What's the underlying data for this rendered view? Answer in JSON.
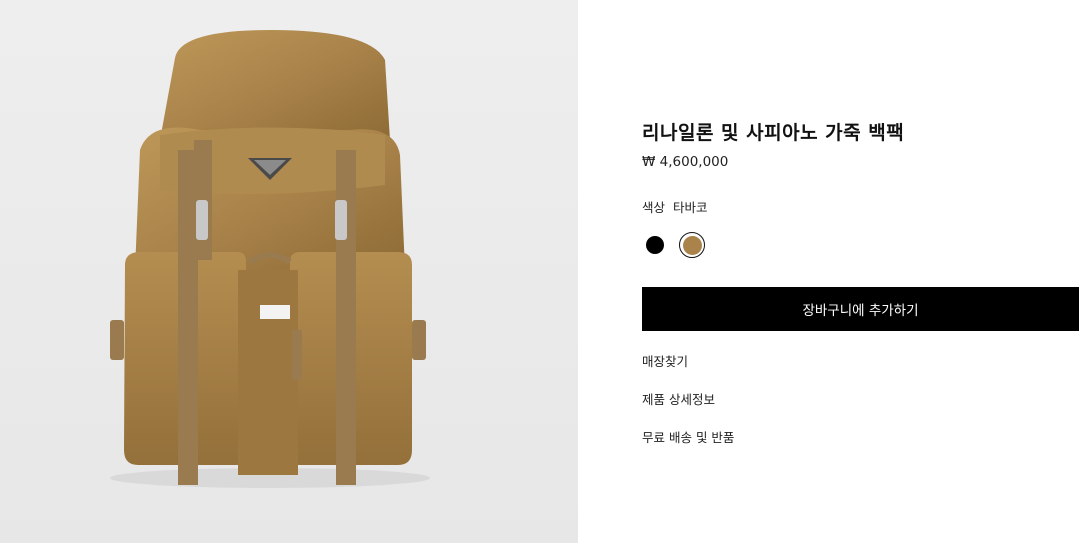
{
  "product": {
    "image_alt": "리나일론 및 사피아노 가죽 백팩",
    "title": "리나일론 및 사피아노 가죽 백팩",
    "price": "₩ 4,600,000",
    "color_label": "색상",
    "color_value": "타바코",
    "colors": [
      {
        "name": "black",
        "hex": "#000000"
      },
      {
        "name": "tobacco",
        "hex": "#a9834a"
      }
    ],
    "selected_color": "tobacco"
  },
  "actions": {
    "add_to_cart": "장바구니에 추가하기"
  },
  "links": {
    "find_store": "매장찾기",
    "product_details": "제품 상세정보",
    "shipping_returns": "무료 배송 및 반품"
  },
  "colors": {
    "bag": "#a9834a",
    "bag_dark": "#8c6a36",
    "bag_light": "#bf9a5d",
    "button_bg": "#000000",
    "button_text": "#ffffff"
  }
}
